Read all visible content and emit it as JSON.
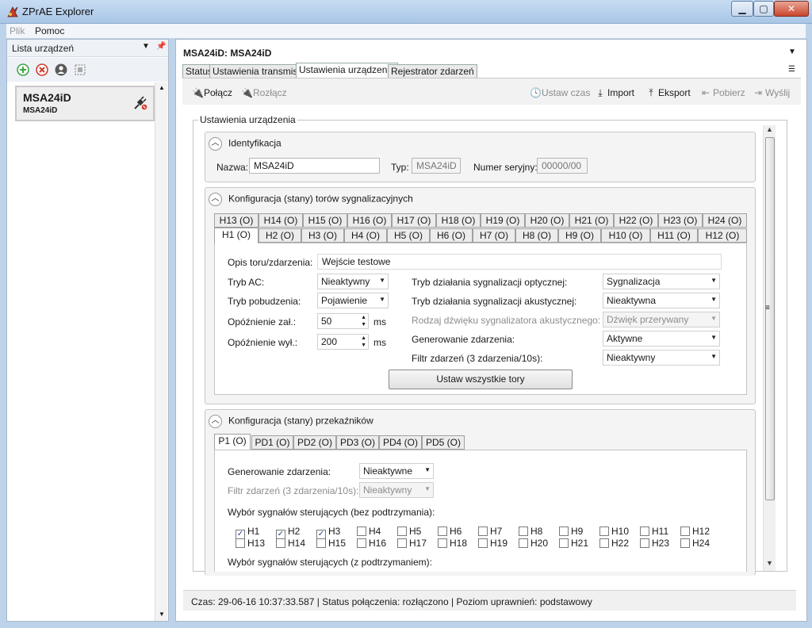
{
  "window": {
    "title": "ZPrAE Explorer",
    "min": "▁",
    "max": "▢",
    "close": "✕"
  },
  "menu": {
    "plik": "Plik",
    "pomoc": "Pomoc"
  },
  "left_panel": {
    "title": "Lista urządzeń",
    "device": {
      "name": "MSA24iD",
      "subtitle": "MSA24iD"
    }
  },
  "main": {
    "title": "MSA24iD: MSA24iD",
    "tabs": [
      "Status",
      "Ustawienia transmisji",
      "Ustawienia urządzenia",
      "Rejestrator zdarzeń"
    ],
    "toolbar": {
      "connect": "Połącz",
      "disconnect": "Rozłącz",
      "set_time": "Ustaw czas",
      "import": "Import",
      "export": "Eksport",
      "fetch": "Pobierz",
      "send": "Wyślij"
    },
    "group_title": "Ustawienia urządzenia",
    "identification": {
      "header": "Identyfikacja",
      "name_label": "Nazwa:",
      "name_value": "MSA24iD",
      "type_label": "Typ:",
      "type_value": "MSA24iD",
      "serial_label": "Numer seryjny:",
      "serial_value": "00000/00"
    },
    "tracks": {
      "header": "Konfiguracja (stany) torów sygnalizacyjnych",
      "tabs_row1": [
        "H13 (O)",
        "H14 (O)",
        "H15 (O)",
        "H16 (O)",
        "H17 (O)",
        "H18 (O)",
        "H19 (O)",
        "H20 (O)",
        "H21 (O)",
        "H22 (O)",
        "H23 (O)",
        "H24 (O)"
      ],
      "tabs_row2": [
        "H1 (O)",
        "H2 (O)",
        "H3 (O)",
        "H4 (O)",
        "H5 (O)",
        "H6 (O)",
        "H7 (O)",
        "H8 (O)",
        "H9 (O)",
        "H10 (O)",
        "H11 (O)",
        "H12 (O)"
      ],
      "desc_label": "Opis toru/zdarzenia:",
      "desc_value": "Wejście testowe",
      "ac_label": "Tryb AC:",
      "ac_value": "Nieaktywny",
      "excite_label": "Tryb pobudzenia:",
      "excite_value": "Pojawienie",
      "on_delay_label": "Opóźnienie zał.:",
      "on_delay_value": "50",
      "off_delay_label": "Opóźnienie wył.:",
      "off_delay_value": "200",
      "unit": "ms",
      "optic_label": "Tryb działania sygnalizacji optycznej:",
      "optic_value": "Sygnalizacja",
      "acoustic_label": "Tryb działania sygnalizacji akustycznej:",
      "acoustic_value": "Nieaktywna",
      "sound_label": "Rodzaj dźwięku sygnalizatora akustycznego:",
      "sound_value": "Dźwięk przerywany",
      "event_label": "Generowanie zdarzenia:",
      "event_value": "Aktywne",
      "filter_label": "Filtr zdarzeń (3 zdarzenia/10s):",
      "filter_value": "Nieaktywny",
      "set_all_button": "Ustaw wszystkie tory"
    },
    "relays": {
      "header": "Konfiguracja (stany) przekaźników",
      "tabs": [
        "P1 (O)",
        "PD1 (O)",
        "PD2 (O)",
        "PD3 (O)",
        "PD4 (O)",
        "PD5 (O)"
      ],
      "event_label": "Generowanie zdarzenia:",
      "event_value": "Nieaktywne",
      "filter_label": "Filtr zdarzeń (3 zdarzenia/10s):",
      "filter_value": "Nieaktywny",
      "signals_label": "Wybór sygnałów sterujących (bez podtrzymania):",
      "signals_row1": [
        "H1",
        "H2",
        "H3",
        "H4",
        "H5",
        "H6",
        "H7",
        "H8",
        "H9",
        "H10",
        "H11",
        "H12"
      ],
      "signals_row2": [
        "H13",
        "H14",
        "H15",
        "H16",
        "H17",
        "H18",
        "H19",
        "H20",
        "H21",
        "H22",
        "H23",
        "H24"
      ],
      "checked": [
        "H1",
        "H2",
        "H3"
      ],
      "signals_latched_label": "Wybór sygnałów sterujących (z podtrzymaniem):"
    },
    "status": "Czas: 29-06-16 10:37:33.587  |  Status połączenia: rozłączono  |  Poziom uprawnień: podstawowy"
  },
  "icons": {
    "app": "app-logo-icon",
    "add": "add-icon",
    "remove": "remove-icon",
    "user": "user-icon",
    "select": "select-icon",
    "plug": "plug-icon",
    "clock": "clock-icon"
  },
  "colors": {
    "add": "#3ea543",
    "remove": "#d23a2a",
    "check": "#1d3f8c"
  }
}
